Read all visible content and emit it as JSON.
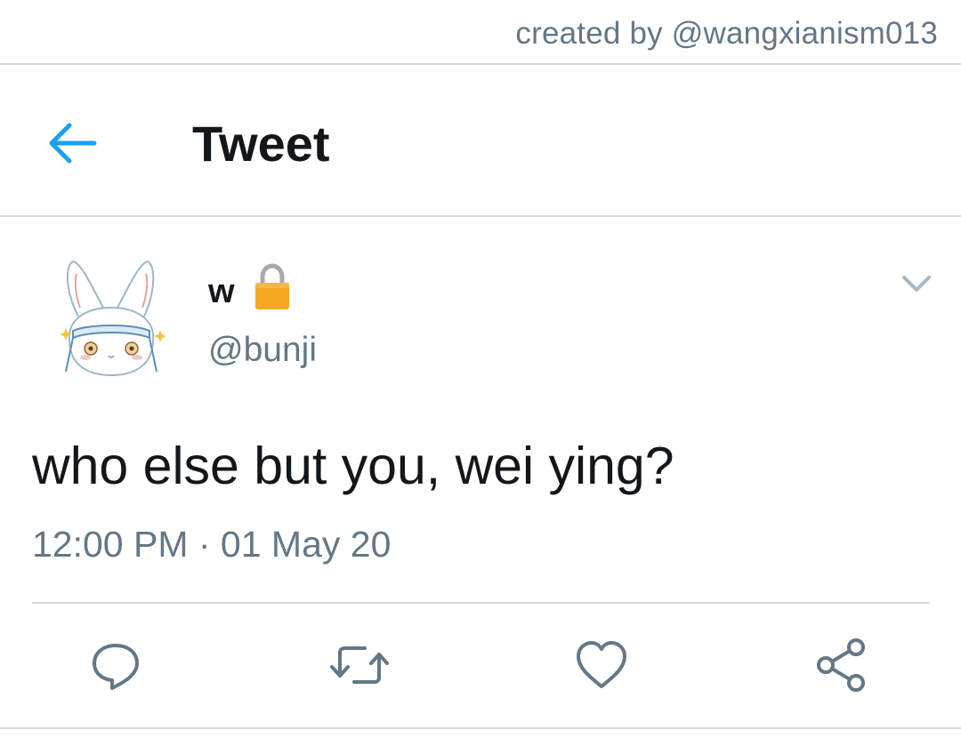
{
  "credit": {
    "text": "created by @wangxianism013"
  },
  "header": {
    "back_icon": "arrow-left-icon",
    "title": "Tweet"
  },
  "tweet": {
    "author": {
      "display_name": "w",
      "handle": "@bunji",
      "avatar_icon": "bunny-avatar",
      "protected_icon": "lock-icon"
    },
    "menu_icon": "chevron-down-icon",
    "text": "who else but you, wei ying?",
    "timestamp": "12:00 PM · 01 May 20",
    "actions": [
      {
        "name": "reply",
        "icon": "speech-bubble-icon"
      },
      {
        "name": "retweet",
        "icon": "retweet-icon"
      },
      {
        "name": "like",
        "icon": "heart-icon"
      },
      {
        "name": "share",
        "icon": "share-icon"
      }
    ]
  },
  "colors": {
    "accent": "#1da1f2",
    "text_primary": "#14171a",
    "text_secondary": "#657786",
    "divider": "#d3dae0",
    "lock": "#f5a623"
  }
}
